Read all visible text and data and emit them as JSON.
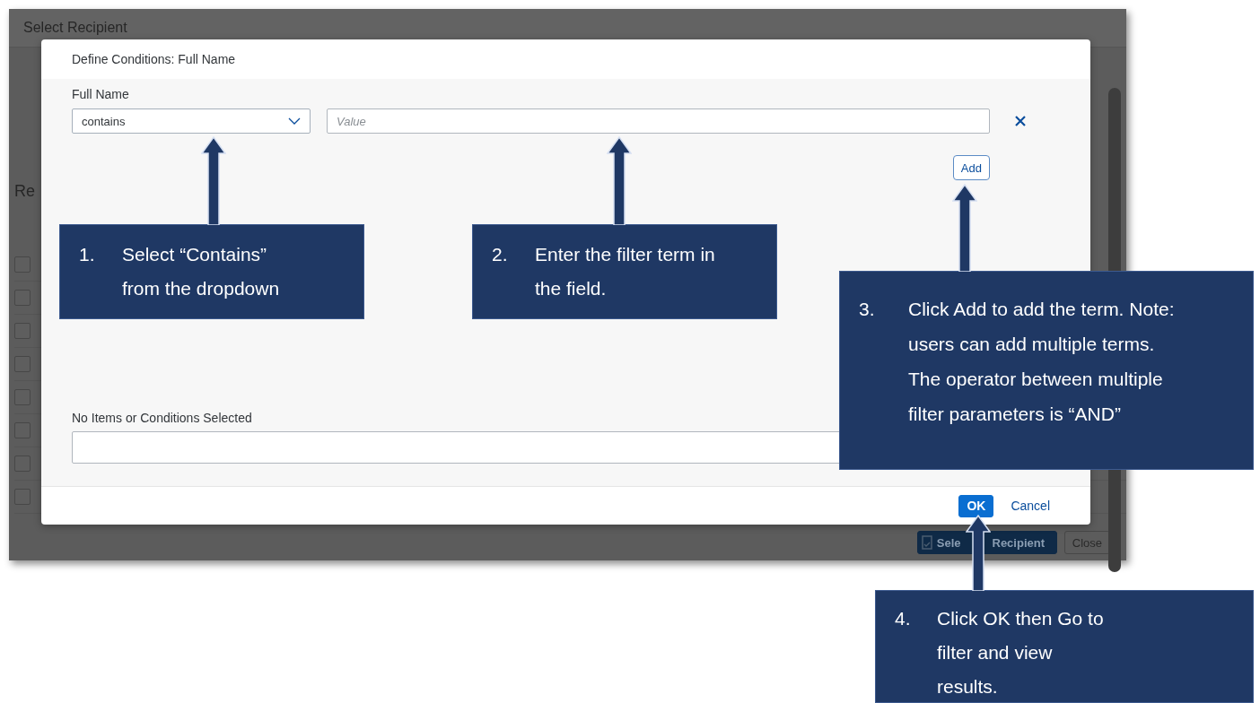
{
  "background_window": {
    "title": "Select Recipient",
    "section_title": "Re",
    "rows": [
      {
        "checked": false
      },
      {
        "checked": false
      },
      {
        "checked": false
      },
      {
        "checked": false
      },
      {
        "checked": false
      },
      {
        "checked": false
      },
      {
        "checked": false
      },
      {
        "checked": false
      }
    ],
    "footer_buttons": [
      {
        "label_parts": [
          "Sele",
          "Recipient"
        ],
        "kind": "primary"
      },
      {
        "label": "Close",
        "kind": "secondary"
      }
    ]
  },
  "dialog": {
    "title": "Define Conditions: Full Name",
    "field_label": "Full Name",
    "operator": {
      "value": "contains"
    },
    "value_field": {
      "placeholder": "Value"
    },
    "add_button": "Add",
    "selection_label": "No Items or Conditions Selected",
    "buttons": [
      {
        "label": "OK",
        "kind": "emphasized"
      },
      {
        "label": "Cancel",
        "kind": "transparent"
      }
    ]
  },
  "callouts": [
    {
      "number": "1.",
      "text": "Select “Contains” from the dropdown"
    },
    {
      "number": "2.",
      "text": "Enter the filter term in the field."
    },
    {
      "number": "3.",
      "text": "Click Add to add the term. Note: users can add multiple terms.  The operator between multiple filter parameters is “AND”"
    },
    {
      "number": "4.",
      "text": "Click OK then Go to filter and view results."
    }
  ]
}
